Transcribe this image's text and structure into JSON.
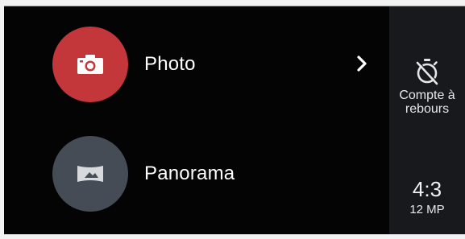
{
  "modes": [
    {
      "label": "Photo",
      "icon": "camera-icon",
      "color": "#c3373a"
    },
    {
      "label": "Panorama",
      "icon": "panorama-icon",
      "color": "#464c56"
    }
  ],
  "expand_icon": "chevron-right-icon",
  "side_panel": {
    "timer": {
      "icon": "timer-off-icon",
      "label_line1": "Compte à",
      "label_line2": "rebours"
    },
    "aspect_ratio": {
      "value": "4:3",
      "resolution": "12 MP"
    }
  },
  "colors": {
    "background": "#040404",
    "side_panel": "#17191c"
  }
}
